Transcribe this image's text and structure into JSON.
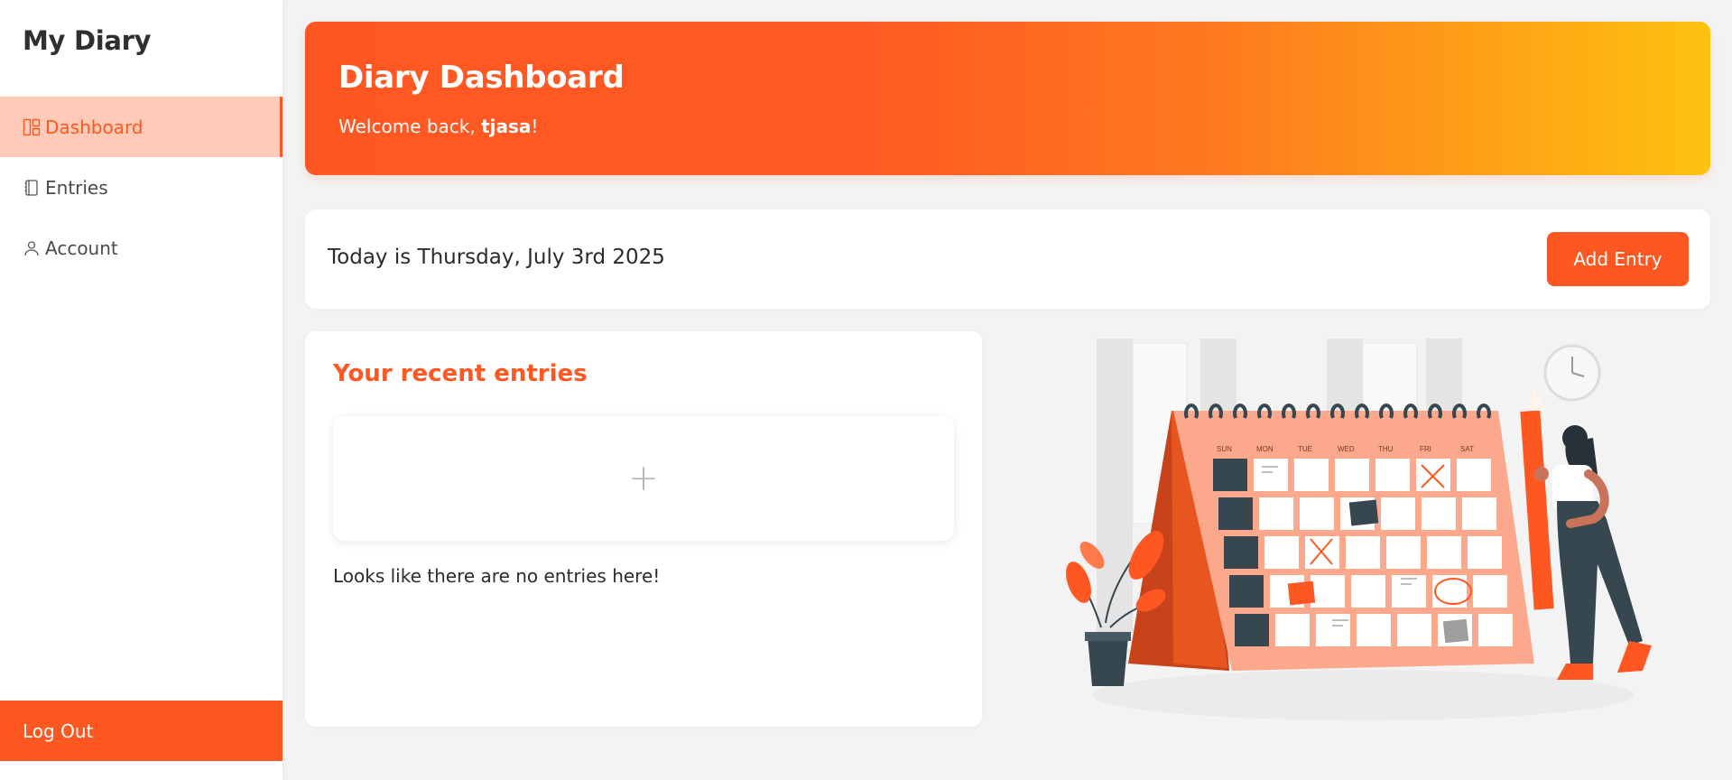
{
  "sidebar": {
    "brand": "My Diary",
    "items": [
      {
        "label": "Dashboard",
        "icon": "dashboard-icon",
        "active": true
      },
      {
        "label": "Entries",
        "icon": "notebook-icon",
        "active": false
      },
      {
        "label": "Account",
        "icon": "user-icon",
        "active": false
      }
    ],
    "logout_label": "Log Out"
  },
  "hero": {
    "title": "Diary Dashboard",
    "welcome_prefix": "Welcome back, ",
    "username": "tjasa",
    "welcome_suffix": "!"
  },
  "date_card": {
    "today": "Today is Thursday, July 3rd 2025",
    "add_label": "Add Entry"
  },
  "entries": {
    "title": "Your recent entries",
    "add_symbol": "+",
    "empty_message": "Looks like there are no entries here!"
  },
  "illustration": {
    "weekdays": [
      "SUN",
      "MON",
      "TUE",
      "WED",
      "THU",
      "FRI",
      "SAT"
    ]
  },
  "colors": {
    "accent": "#ff5722",
    "accent_light": "#ffcbb8",
    "gradient_end": "#fdc20f",
    "background": "#f3f3f3"
  }
}
